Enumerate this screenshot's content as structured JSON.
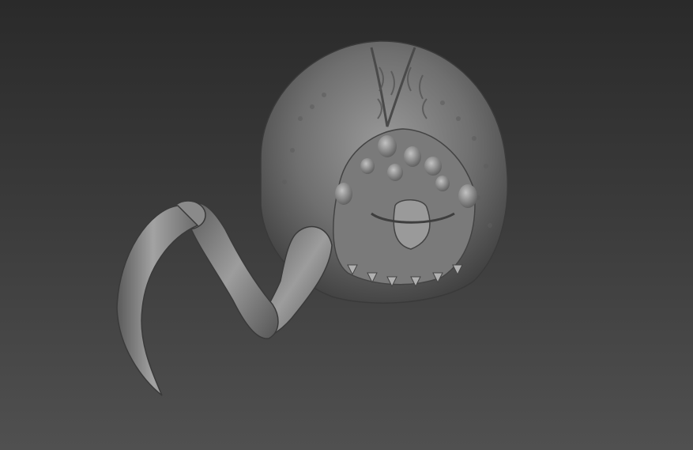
{
  "viewport": {
    "background_top": "#2a2a2a",
    "background_bottom": "#505050"
  },
  "model": {
    "icon": "creature-sculpt-render",
    "material_color": "#8a8a8a"
  }
}
